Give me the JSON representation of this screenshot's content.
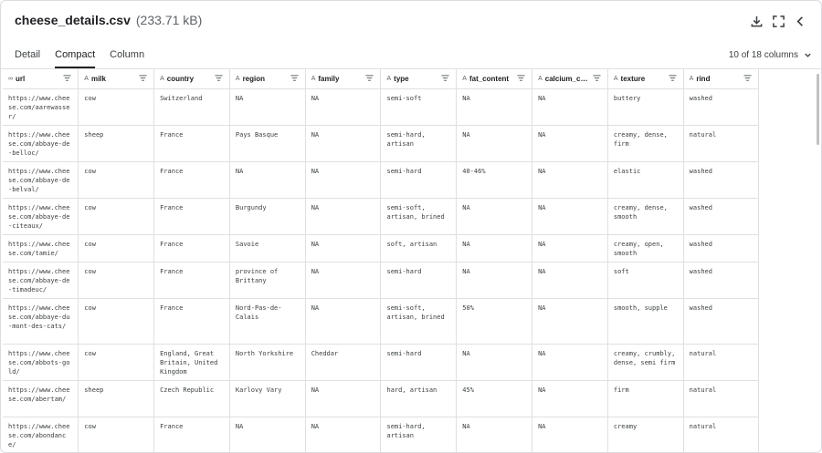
{
  "file": {
    "name": "cheese_details.csv",
    "size": "(233.71 kB)"
  },
  "tabs": [
    {
      "label": "Detail"
    },
    {
      "label": "Compact"
    },
    {
      "label": "Column"
    }
  ],
  "column_count": "10 of 18 columns",
  "columns": [
    {
      "type_icon": "∞",
      "label": "url"
    },
    {
      "type_icon": "A",
      "label": "milk"
    },
    {
      "type_icon": "A",
      "label": "country"
    },
    {
      "type_icon": "A",
      "label": "region"
    },
    {
      "type_icon": "A",
      "label": "family"
    },
    {
      "type_icon": "A",
      "label": "type"
    },
    {
      "type_icon": "A",
      "label": "fat_content"
    },
    {
      "type_icon": "A",
      "label": "calcium_c…"
    },
    {
      "type_icon": "A",
      "label": "texture"
    },
    {
      "type_icon": "A",
      "label": "rind"
    }
  ],
  "rows": [
    [
      "https://www.cheese.com/aarewasser/",
      "cow",
      "Switzerland",
      "NA",
      "NA",
      "semi-soft",
      "NA",
      "NA",
      "buttery",
      "washed"
    ],
    [
      "https://www.cheese.com/abbaye-de-belloc/",
      "sheep",
      "France",
      "Pays Basque",
      "NA",
      "semi-hard, artisan",
      "NA",
      "NA",
      "creamy, dense, firm",
      "natural"
    ],
    [
      "https://www.cheese.com/abbaye-de-belval/",
      "cow",
      "France",
      "NA",
      "NA",
      "semi-hard",
      "40-46%",
      "NA",
      "elastic",
      "washed"
    ],
    [
      "https://www.cheese.com/abbaye-de-citeaux/",
      "cow",
      "France",
      "Burgundy",
      "NA",
      "semi-soft, artisan, brined",
      "NA",
      "NA",
      "creamy, dense, smooth",
      "washed"
    ],
    [
      "https://www.cheese.com/tamie/",
      "cow",
      "France",
      "Savoie",
      "NA",
      "soft, artisan",
      "NA",
      "NA",
      "creamy, open, smooth",
      "washed"
    ],
    [
      "https://www.cheese.com/abbaye-de-timadeuc/",
      "cow",
      "France",
      "province of Brittany",
      "NA",
      "semi-hard",
      "NA",
      "NA",
      "soft",
      "washed"
    ],
    [
      "https://www.cheese.com/abbaye-du-mont-des-cats/",
      "cow",
      "France",
      "Nord-Pas-de-Calais",
      "NA",
      "semi-soft, artisan, brined",
      "50%",
      "NA",
      "smooth, supple",
      "washed"
    ],
    [
      "https://www.cheese.com/abbots-gold/",
      "cow",
      "England, Great Britain, United Kingdom",
      "North Yorkshire",
      "Cheddar",
      "semi-hard",
      "NA",
      "NA",
      "creamy, crumbly, dense, semi firm",
      "natural"
    ],
    [
      "https://www.cheese.com/abertam/",
      "sheep",
      "Czech Republic",
      "Karlovy Vary",
      "NA",
      "hard, artisan",
      "45%",
      "NA",
      "firm",
      "natural"
    ],
    [
      "https://www.cheese.com/abondance/",
      "cow",
      "France",
      "NA",
      "NA",
      "semi-hard, artisan",
      "NA",
      "NA",
      "creamy",
      "natural"
    ]
  ],
  "icons": {
    "download": "download-icon",
    "fullscreen": "fullscreen-icon",
    "collapse": "chevron-left-icon",
    "dropdown": "chevron-down-icon",
    "sort": "sort-icon"
  }
}
